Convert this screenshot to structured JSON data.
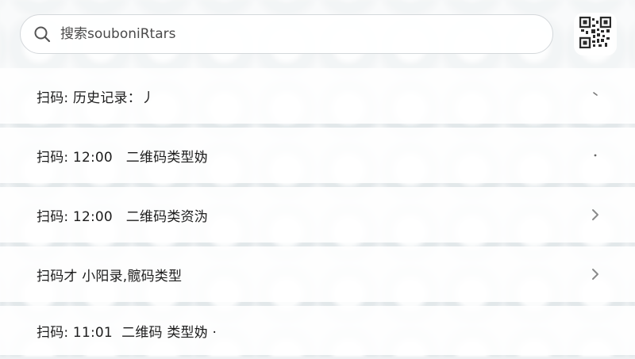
{
  "search": {
    "placeholder": "搜索souboniRtars"
  },
  "icons": {
    "search": "search-icon",
    "qr_code": "qr-code-icon",
    "chevron": "chevron-right-icon"
  },
  "colors": {
    "text_primary": "#1c1c1c",
    "placeholder": "#4a4a4a",
    "chevron": "#8a8a8a"
  },
  "history": {
    "items": [
      {
        "text": "扫码: 历史记录：丿",
        "trailing": "tick"
      },
      {
        "text": "扫码: 12:00   二维码类型妫",
        "trailing": "dot"
      },
      {
        "text": "扫码: 12:00   二维码类资沩",
        "trailing": "chevron"
      },
      {
        "text": "扫码才 小阳录,髋码类型",
        "trailing": "chevron"
      },
      {
        "text": "扫码: 11:01  二维码 类型妫 ·",
        "trailing": "none"
      }
    ]
  }
}
